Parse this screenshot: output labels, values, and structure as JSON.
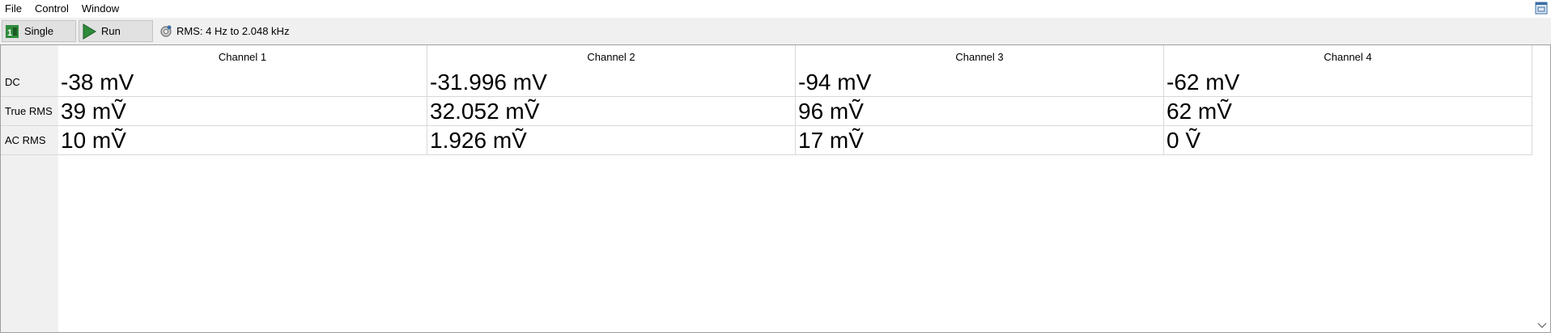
{
  "menu": [
    "File",
    "Control",
    "Window"
  ],
  "toolbar": {
    "single_label": "Single",
    "run_label": "Run",
    "rms_label": "RMS: 4 Hz to 2.048 kHz"
  },
  "table": {
    "columns": [
      "Channel 1",
      "Channel 2",
      "Channel 3",
      "Channel 4"
    ],
    "rows": [
      {
        "label": "DC",
        "values": [
          "-38 mV",
          "-31.996 mV",
          "-94 mV",
          "-62 mV"
        ]
      },
      {
        "label": "True RMS",
        "values": [
          "39 mṼ",
          "32.052 mṼ",
          "96 mṼ",
          "62 mṼ"
        ]
      },
      {
        "label": "AC RMS",
        "values": [
          "10 mṼ",
          "1.926 mṼ",
          "17 mṼ",
          "0 Ṽ"
        ]
      }
    ]
  },
  "colors": {
    "run_icon": "#2e8b3a",
    "single_icon": "#2e8b3a",
    "window_icon": "#3a6ea5"
  }
}
